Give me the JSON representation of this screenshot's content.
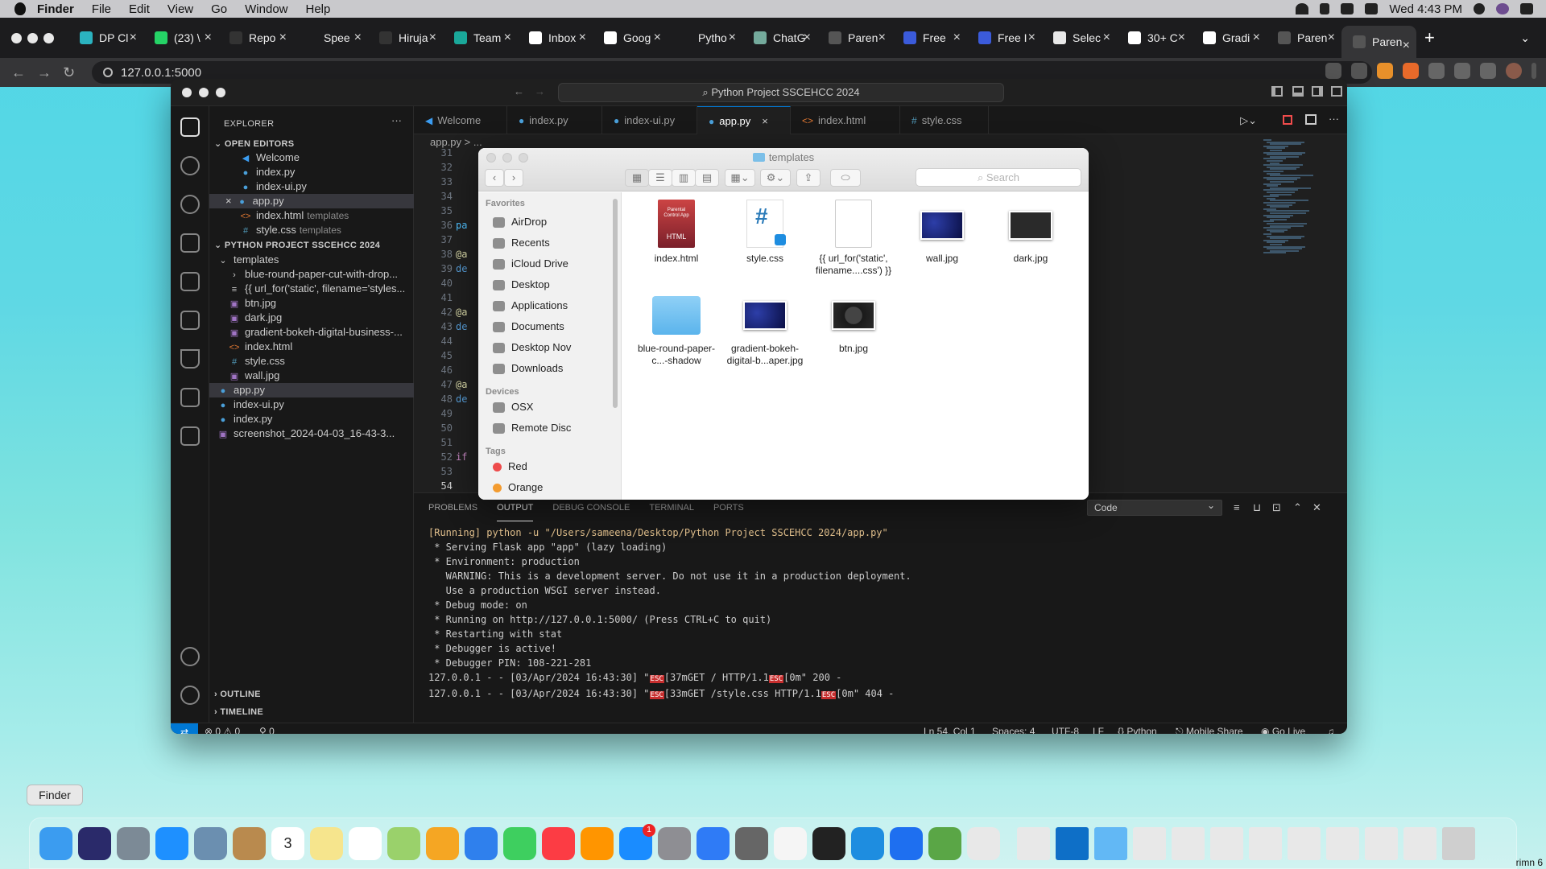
{
  "menubar": {
    "app": "Finder",
    "items": [
      "File",
      "Edit",
      "View",
      "Go",
      "Window",
      "Help"
    ],
    "clock": "Wed 4:43 PM"
  },
  "browser": {
    "tabs": [
      {
        "label": "DP Cl",
        "color": "#2bb3c0"
      },
      {
        "label": "(23) \\",
        "color": "#25d366"
      },
      {
        "label": "Repo",
        "color": "#333333"
      },
      {
        "label": "Spee",
        "color": "#1c1c1e"
      },
      {
        "label": "Hiruja",
        "color": "#333333"
      },
      {
        "label": "Team",
        "color": "#1aa89a"
      },
      {
        "label": "Inbox",
        "color": "#ffffff"
      },
      {
        "label": "Goog",
        "color": "#ffffff"
      },
      {
        "label": "Pytho",
        "color": "#1c1c1e"
      },
      {
        "label": "ChatG",
        "color": "#74aa9c"
      },
      {
        "label": "Paren",
        "color": "#555555"
      },
      {
        "label": "Free",
        "color": "#3b5bdb"
      },
      {
        "label": "Free I",
        "color": "#3b5bdb"
      },
      {
        "label": "Selec",
        "color": "#e8e8e8"
      },
      {
        "label": "30+ C",
        "color": "#ffffff"
      },
      {
        "label": "Gradi",
        "color": "#ffffff"
      },
      {
        "label": "Paren",
        "color": "#555555"
      },
      {
        "label": "Paren",
        "color": "#555555"
      }
    ],
    "active_tab_index": 17,
    "url": "127.0.0.1:5000"
  },
  "vscode": {
    "search_title": "Python Project SSCEHCC 2024",
    "explorer_title": "EXPLORER",
    "open_editors_title": "OPEN EDITORS",
    "open_editors": [
      {
        "icon": "vscode",
        "name": "Welcome",
        "desc": ""
      },
      {
        "icon": "py",
        "name": "index.py",
        "desc": ""
      },
      {
        "icon": "py",
        "name": "index-ui.py",
        "desc": ""
      },
      {
        "icon": "py",
        "name": "app.py",
        "desc": ""
      },
      {
        "icon": "html",
        "name": "index.html",
        "desc": "templates"
      },
      {
        "icon": "css",
        "name": "style.css",
        "desc": "templates"
      }
    ],
    "project_title": "PYTHON PROJECT SSCEHCC 2024",
    "tree": [
      {
        "indent": 1,
        "icon": "chev",
        "name": "templates"
      },
      {
        "indent": 2,
        "icon": "chevr",
        "name": "blue-round-paper-cut-with-drop..."
      },
      {
        "indent": 2,
        "icon": "lines",
        "name": "{{ url_for('static', filename='styles..."
      },
      {
        "indent": 2,
        "icon": "img",
        "name": "btn.jpg"
      },
      {
        "indent": 2,
        "icon": "img",
        "name": "dark.jpg"
      },
      {
        "indent": 2,
        "icon": "img",
        "name": "gradient-bokeh-digital-business-..."
      },
      {
        "indent": 2,
        "icon": "html",
        "name": "index.html"
      },
      {
        "indent": 2,
        "icon": "css",
        "name": "style.css"
      },
      {
        "indent": 2,
        "icon": "img",
        "name": "wall.jpg"
      },
      {
        "indent": 1,
        "icon": "py",
        "name": "app.py"
      },
      {
        "indent": 1,
        "icon": "py",
        "name": "index-ui.py"
      },
      {
        "indent": 1,
        "icon": "py",
        "name": "index.py"
      },
      {
        "indent": 1,
        "icon": "img",
        "name": "screenshot_2024-04-03_16-43-3..."
      }
    ],
    "outline": "OUTLINE",
    "timeline": "TIMELINE",
    "editor_tabs": [
      {
        "icon": "vscode",
        "name": "Welcome"
      },
      {
        "icon": "py",
        "name": "index.py"
      },
      {
        "icon": "py",
        "name": "index-ui.py"
      },
      {
        "icon": "py",
        "name": "app.py"
      },
      {
        "icon": "html",
        "name": "index.html"
      },
      {
        "icon": "css",
        "name": "style.css"
      }
    ],
    "active_editor_tab": 3,
    "breadcrumb": "app.py > ...",
    "line_numbers": [
      "31",
      "32",
      "33",
      "34",
      "35",
      "36",
      "37",
      "38",
      "39",
      "40",
      "41",
      "42",
      "43",
      "44",
      "45",
      "46",
      "47",
      "48",
      "49",
      "50",
      "51",
      "52",
      "53",
      "54"
    ],
    "current_line": "54",
    "code_fragments": [
      {
        "line": "36",
        "text": "pa",
        "color": "#4fc1ff"
      },
      {
        "line": "38",
        "text": "@a",
        "color": "#dcdcaa"
      },
      {
        "line": "39",
        "text": "de",
        "color": "#569cd6"
      },
      {
        "line": "42",
        "text": "@a",
        "color": "#dcdcaa"
      },
      {
        "line": "43",
        "text": "de",
        "color": "#569cd6"
      },
      {
        "line": "47",
        "text": "@a",
        "color": "#dcdcaa"
      },
      {
        "line": "48",
        "text": "de",
        "color": "#569cd6"
      },
      {
        "line": "52",
        "text": "if",
        "color": "#c586c0"
      }
    ],
    "panel_tabs": [
      "PROBLEMS",
      "OUTPUT",
      "DEBUG CONSOLE",
      "TERMINAL",
      "PORTS"
    ],
    "active_panel_tab": 1,
    "output_channel": "Code",
    "output_lines": [
      {
        "cls": "run",
        "text": "[Running] python -u \"/Users/sameena/Desktop/Python Project SSCEHCC 2024/app.py\""
      },
      {
        "cls": "",
        "text": " * Serving Flask app \"app\" (lazy loading)"
      },
      {
        "cls": "",
        "text": " * Environment: production"
      },
      {
        "cls": "",
        "text": "   WARNING: This is a development server. Do not use it in a production deployment."
      },
      {
        "cls": "",
        "text": "   Use a production WSGI server instead."
      },
      {
        "cls": "",
        "text": " * Debug mode: on"
      },
      {
        "cls": "",
        "text": " * Running on http://127.0.0.1:5000/ (Press CTRL+C to quit)"
      },
      {
        "cls": "",
        "text": " * Restarting with stat"
      },
      {
        "cls": "",
        "text": " * Debugger is active!"
      },
      {
        "cls": "",
        "text": " * Debugger PIN: 108-221-281"
      },
      {
        "cls": "",
        "text": "127.0.0.1 - - [03/Apr/2024 16:43:30] \"ESC[37mGET / HTTP/1.1ESC[0m\" 200 -"
      },
      {
        "cls": "",
        "text": "127.0.0.1 - - [03/Apr/2024 16:43:30] \"ESC[33mGET /style.css HTTP/1.1ESC[0m\" 404 -"
      }
    ],
    "status": {
      "errors": "0",
      "warnings": "0",
      "ports": "0",
      "position": "Ln 54, Col 1",
      "spaces": "Spaces: 4",
      "encoding": "UTF-8",
      "eol": "LF",
      "language": "Python",
      "mobile_share": "Mobile Share",
      "go_live": "Go Live"
    }
  },
  "finder": {
    "title": "templates",
    "search_placeholder": "Search",
    "favorites_title": "Favorites",
    "favorites": [
      "AirDrop",
      "Recents",
      "iCloud Drive",
      "Desktop",
      "Applications",
      "Documents",
      "Desktop Nov",
      "Downloads"
    ],
    "devices_title": "Devices",
    "devices": [
      "OSX",
      "Remote Disc"
    ],
    "tags_title": "Tags",
    "tags": [
      {
        "name": "Red",
        "color": "#ee4b4b"
      },
      {
        "name": "Orange",
        "color": "#f39b2f"
      }
    ],
    "files": [
      {
        "name": "index.html",
        "type": "html",
        "sub": "Parental Control App",
        "badge": "HTML"
      },
      {
        "name": "style.css",
        "type": "css"
      },
      {
        "name": "{{ url_for('static', filename....css') }}",
        "type": "blank"
      },
      {
        "name": "wall.jpg",
        "type": "img-blue"
      },
      {
        "name": "dark.jpg",
        "type": "img-dark"
      },
      {
        "name": "blue-round-paper-c...-shadow",
        "type": "folder"
      },
      {
        "name": "gradient-bokeh-digital-b...aper.jpg",
        "type": "img-blue"
      },
      {
        "name": "btn.jpg",
        "type": "img-btn"
      }
    ]
  },
  "dock": {
    "tooltip": "Finder",
    "apps": [
      "#3b9cf0",
      "#2a2a6a",
      "#7c8a96",
      "#1e90ff",
      "#6b8fb0",
      "#b98a4e",
      "#ffffff",
      "#f6e58d",
      "#ffffff",
      "#9ad16b",
      "#f5a623",
      "#2f80ed",
      "#3ecf5f",
      "#fc3c44",
      "#ff9500",
      "#1a8cff",
      "#8e8e93",
      "#2f7bf6",
      "#666666",
      "#f5f5f5",
      "#222222",
      "#1e8de0",
      "#1e6ff0",
      "#5aa646",
      "#e8e8e8",
      "#e8e8e8",
      "#0e6fc7",
      "#62b8f5",
      "#e8e8e8",
      "#e8e8e8",
      "#e8e8e8",
      "#e8e8e8",
      "#e8e8e8",
      "#e8e8e8",
      "#e8e8e8",
      "#e8e8e8",
      "#cfcfcf"
    ],
    "appstore_badge": "1",
    "calendar_day": "3",
    "corner_text": "rimn 6"
  }
}
